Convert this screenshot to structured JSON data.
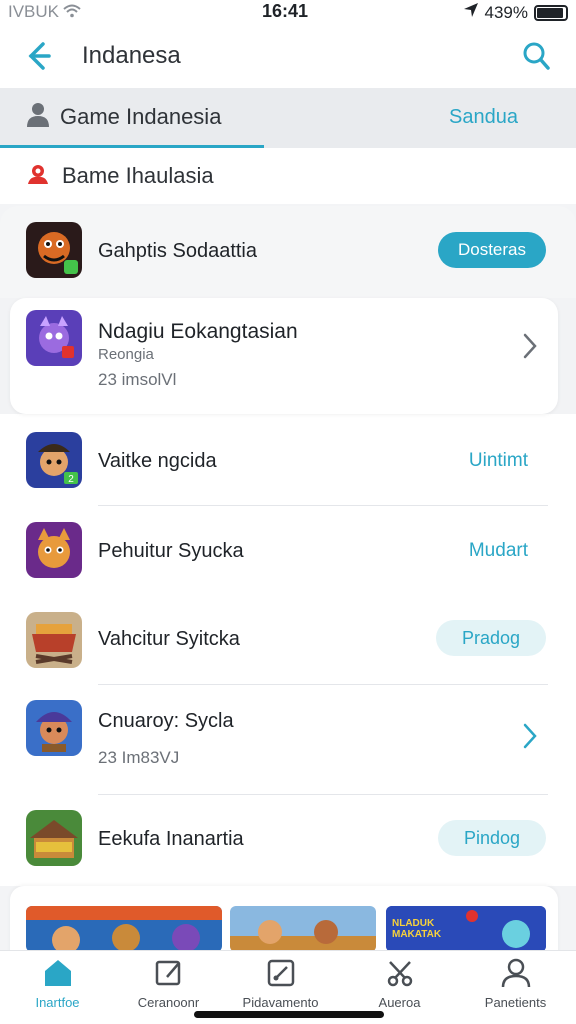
{
  "status_bar": {
    "carrier": "IVBUK",
    "time": "16:41",
    "battery": "439%"
  },
  "header": {
    "title": "Indanesa"
  },
  "tabs": {
    "main_label": "Game Indanesia",
    "right_label": "Sandua"
  },
  "section": {
    "title": "Bame Ihaulasia"
  },
  "rows": [
    {
      "name": "Gahptis Sodaattia",
      "action": "Dosteras"
    },
    {
      "name": "Ndagiu Eokangtasian",
      "sub": "Reongia",
      "meta": "23 imsolVl"
    },
    {
      "name": "Vaitke ngcida",
      "action": "Uintimt"
    },
    {
      "name": "Pehuitur Syucka",
      "action": "Mudart"
    },
    {
      "name": "Vahcitur Syitcka",
      "action": "Pradog"
    },
    {
      "name": "Cnuaroy: Sycla",
      "meta": "23 Im83VJ"
    },
    {
      "name": "Eekufa Inanartia",
      "action": "Pindog"
    }
  ],
  "banners": [
    {
      "text": ""
    },
    {
      "text": ""
    },
    {
      "text": "NLADUK MAKATAK"
    }
  ],
  "tab_bar": [
    {
      "label": "Inartfoe",
      "icon": "home-icon"
    },
    {
      "label": "Ceranoonr",
      "icon": "edit-icon"
    },
    {
      "label": "Pidavamento",
      "icon": "pen-icon"
    },
    {
      "label": "Aueroa",
      "icon": "scissors-icon"
    },
    {
      "label": "Panetients",
      "icon": "profile-icon"
    }
  ],
  "colors": {
    "accent": "#2aa6c6",
    "soft_accent": "#e3f3f6",
    "background": "#f3f4f6"
  }
}
